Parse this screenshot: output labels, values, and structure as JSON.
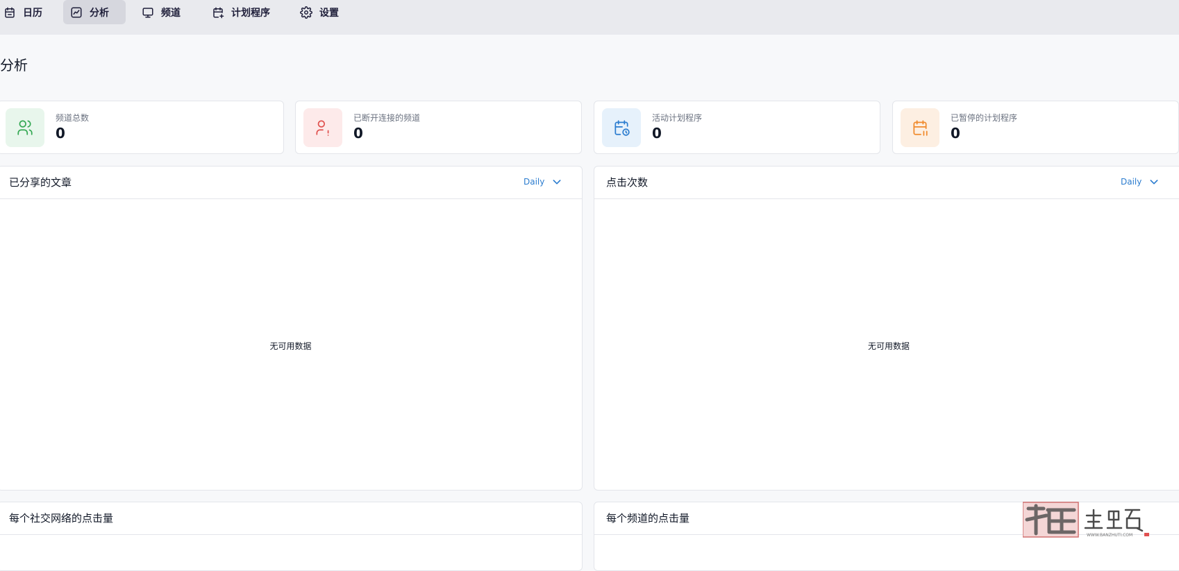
{
  "nav": {
    "items": [
      {
        "label": "日历",
        "icon": "calendar-icon",
        "active": false
      },
      {
        "label": "分析",
        "icon": "chart-icon",
        "active": true
      },
      {
        "label": "频道",
        "icon": "monitor-icon",
        "active": false
      },
      {
        "label": "计划程序",
        "icon": "calendar-plus-icon",
        "active": false
      },
      {
        "label": "设置",
        "icon": "gear-icon",
        "active": false
      }
    ]
  },
  "page": {
    "title": "分析"
  },
  "stats": [
    {
      "label": "频道总数",
      "value": "0",
      "icon": "users-icon",
      "color": "#34a853",
      "bg": "#e8f6ec"
    },
    {
      "label": "已断开连接的频道",
      "value": "0",
      "icon": "user-alert-icon",
      "color": "#e0524f",
      "bg": "#fdeaea"
    },
    {
      "label": "活动计划程序",
      "value": "0",
      "icon": "calendar-clock-icon",
      "color": "#2b7ccf",
      "bg": "#e6f1fb"
    },
    {
      "label": "已暂停的计划程序",
      "value": "0",
      "icon": "calendar-pause-icon",
      "color": "#f08a2c",
      "bg": "#fdefe2"
    }
  ],
  "panels": {
    "shared_posts": {
      "title": "已分享的文章",
      "period": "Daily",
      "empty": "无可用数据"
    },
    "clicks": {
      "title": "点击次数",
      "period": "Daily",
      "empty": "无可用数据"
    },
    "clicks_per_network": {
      "title": "每个社交网络的点击量"
    },
    "clicks_per_channel": {
      "title": "每个频道的点击量"
    }
  },
  "watermark": {
    "text": "搬主题",
    "url": "WWW.BANZHUTI.COM"
  },
  "colors": {
    "accent": "#2b7ccf",
    "nav_bg": "#e9eaee",
    "page_bg": "#f7f8fa"
  }
}
